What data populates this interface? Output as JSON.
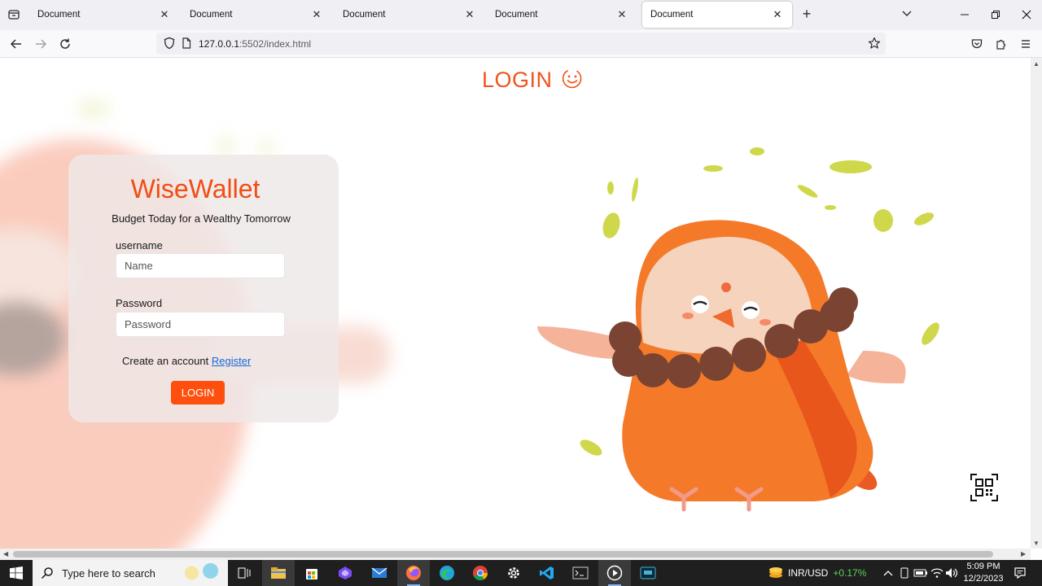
{
  "browser": {
    "tabs": [
      {
        "title": "Document",
        "active": false
      },
      {
        "title": "Document",
        "active": false
      },
      {
        "title": "Document",
        "active": false
      },
      {
        "title": "Document",
        "active": false
      },
      {
        "title": "Document",
        "active": true
      }
    ],
    "url_host": "127.0.0.1",
    "url_rest": ":5502/index.html"
  },
  "page": {
    "header_title": "LOGIN",
    "brand": "WiseWallet",
    "tagline": "Budget Today for a Wealthy Tomorrow",
    "username_label": "username",
    "username_placeholder": "Name",
    "password_label": "Password",
    "password_placeholder": "Password",
    "register_prompt": "Create an account",
    "register_link": "Register",
    "login_button": "LOGIN"
  },
  "taskbar": {
    "search_placeholder": "Type here to search",
    "currency_pair": "INR/USD",
    "currency_change": "+0.17%",
    "time": "5:09 PM",
    "date": "12/2/2023"
  },
  "colors": {
    "accent": "#f2531a",
    "login_button": "#ff4f0e",
    "link": "#1a66d6"
  }
}
